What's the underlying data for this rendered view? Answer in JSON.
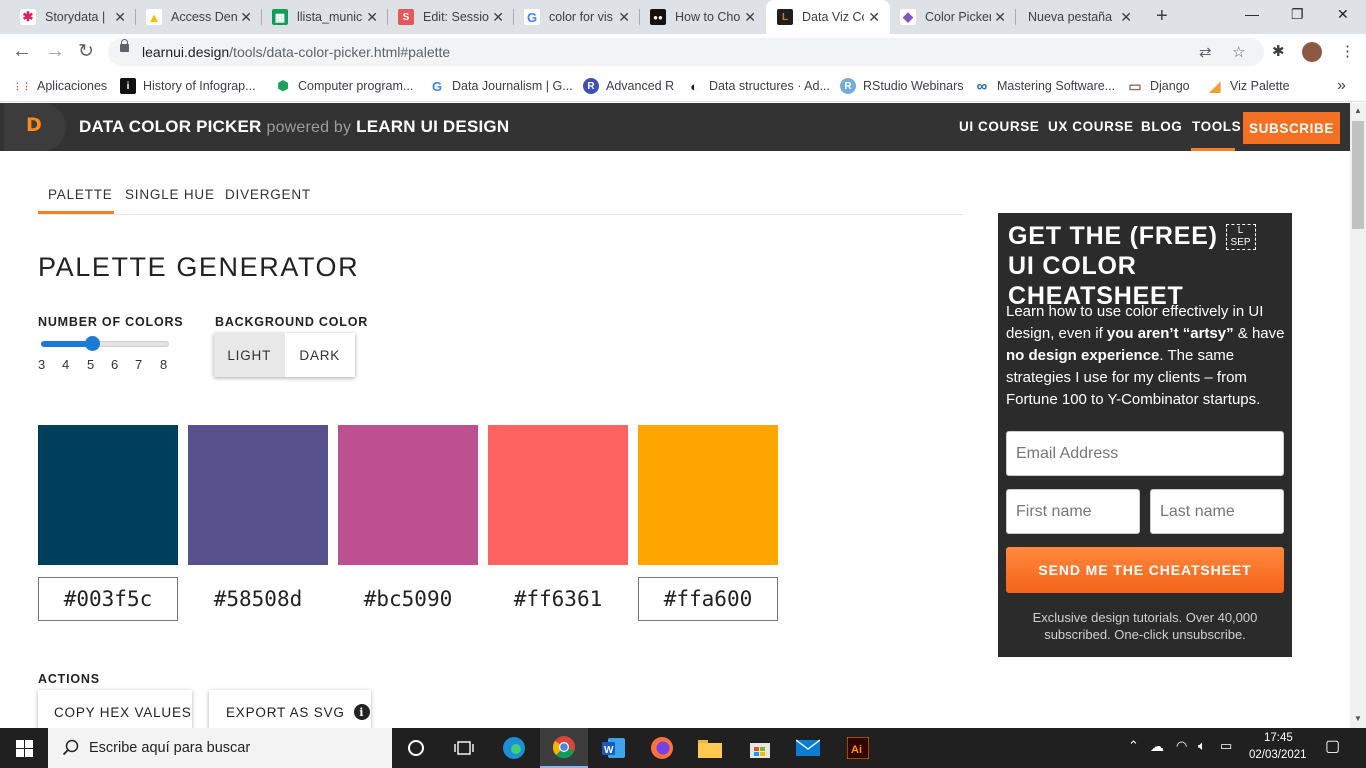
{
  "browser": {
    "tabs": [
      {
        "title": "Storydata |",
        "favicon_color": "#e01e5a",
        "favicon_glyph": "✱"
      },
      {
        "title": "Access Den",
        "favicon_color": "#fbbc04",
        "favicon_glyph": "▲"
      },
      {
        "title": "llista_munic",
        "favicon_color": "#0f9d58",
        "favicon_glyph": "▦"
      },
      {
        "title": "Edit: Sessio",
        "favicon_color": "#e5575a",
        "favicon_glyph": "S"
      },
      {
        "title": "color for vis",
        "favicon_color": "#4285f4",
        "favicon_glyph": "G"
      },
      {
        "title": "How to Cho",
        "favicon_color": "#111111",
        "favicon_glyph": "●●"
      },
      {
        "title": "Data Viz Co",
        "favicon_color": "#e8711c",
        "favicon_glyph": "L"
      },
      {
        "title": "Color Picker",
        "favicon_color": "#7e57c2",
        "favicon_glyph": "◆"
      },
      {
        "title": "Nueva pestaña",
        "favicon_color": "",
        "favicon_glyph": ""
      }
    ],
    "url_host": "learnui.design",
    "url_path": "/tools/data-color-picker.html#palette",
    "bookmarks": [
      {
        "label": "Aplicaciones",
        "icon_color": "#ea4335",
        "glyph": "⋮⋮"
      },
      {
        "label": "History of Infograp...",
        "icon_color": "#111111",
        "glyph": "i"
      },
      {
        "label": "Computer program...",
        "icon_color": "#1aa260",
        "glyph": "⬢"
      },
      {
        "label": "Data Journalism | G...",
        "icon_color": "#4285f4",
        "glyph": "G"
      },
      {
        "label": "Advanced R",
        "icon_color": "#3f51b5",
        "glyph": "R"
      },
      {
        "label": "Data structures · Ad...",
        "icon_color": "#222222",
        "glyph": "◐"
      },
      {
        "label": "RStudio Webinars",
        "icon_color": "#75aadb",
        "glyph": "R"
      },
      {
        "label": "Mastering Software...",
        "icon_color": "#1565c0",
        "glyph": "∞"
      },
      {
        "label": "Django",
        "icon_color": "#8d6e63",
        "glyph": "▭"
      },
      {
        "label": "Viz Palette",
        "icon_color": "#f0a030",
        "glyph": "◢"
      }
    ],
    "bookmarks_more": "»"
  },
  "site": {
    "logo_letter": "D",
    "brand_main": "DATA COLOR PICKER",
    "brand_powered": "powered by",
    "brand_tail": "LEARN UI DESIGN",
    "nav": [
      "UI COURSE",
      "UX COURSE",
      "BLOG",
      "TOOLS"
    ],
    "subscribe": "SUBSCRIBE",
    "accent": "#f58025"
  },
  "tool": {
    "tabs": [
      "PALETTE",
      "SINGLE HUE",
      "DIVERGENT"
    ],
    "title": "PALETTE GENERATOR",
    "num_colors_label": "NUMBER OF COLORS",
    "num_colors_ticks": [
      "3",
      "4",
      "5",
      "6",
      "7",
      "8"
    ],
    "num_colors_value": 5,
    "bg_label": "BACKGROUND COLOR",
    "bg_options": [
      "LIGHT",
      "DARK"
    ],
    "bg_selected": "LIGHT",
    "palette": [
      {
        "hex": "#003f5c"
      },
      {
        "hex": "#58508d"
      },
      {
        "hex": "#bc5090"
      },
      {
        "hex": "#ff6361"
      },
      {
        "hex": "#ffa600"
      }
    ],
    "actions_label": "ACTIONS",
    "actions": [
      "COPY HEX VALUES",
      "EXPORT AS SVG"
    ],
    "info_glyph": "i"
  },
  "cheatsheet": {
    "title_a": "GET THE (FREE)",
    "sep_glyph_top": "L",
    "sep_glyph_bottom": "SEP",
    "title_b": "UI COLOR CHEATSHEET",
    "body_1": "Learn how to use color effectively in UI design, even if ",
    "body_bold_1": "you aren’t “artsy”",
    "body_2": " & have ",
    "body_bold_2": "no design experience",
    "body_3": ". The same strategies I use for my clients – from Fortune 100 to Y-Combinator startups.",
    "email_placeholder": "Email Address",
    "first_placeholder": "First name",
    "last_placeholder": "Last name",
    "send_label": "SEND ME THE CHEATSHEET",
    "fine_print": "Exclusive design tutorials. Over 40,000 subscribed. One-click unsubscribe."
  },
  "taskbar": {
    "search_placeholder": "Escribe aquí para buscar",
    "time": "17:45",
    "date": "02/03/2021"
  }
}
